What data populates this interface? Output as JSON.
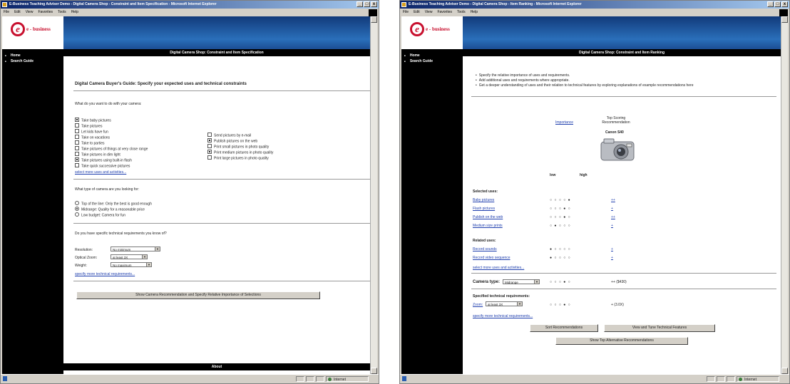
{
  "left_window": {
    "title": "E-Business Teaching Adviser Demo - Digital Camera Shop - Constraint and Item Specification - Microsoft Internet Explorer",
    "menu": [
      "File",
      "Edit",
      "View",
      "Favorites",
      "Tools",
      "Help"
    ],
    "brand": "e - business",
    "nav": [
      "Home",
      "Search Guide"
    ],
    "banner": "Digital Camera Shop: Constraint and Item Specification",
    "heading": "Digital Camera Buyer's Guide: Specify your expected uses and technical constraints",
    "q_uses": "What do you want to do with your camera:",
    "uses_col1": [
      {
        "label": "Take baby pictures",
        "checked": true
      },
      {
        "label": "Take pictures",
        "checked": false
      },
      {
        "label": "Let kids have fun",
        "checked": false
      },
      {
        "label": "Take on vacations",
        "checked": false
      },
      {
        "label": "Take to parties",
        "checked": false
      },
      {
        "label": "Take pictures of things at very close range",
        "checked": false
      },
      {
        "label": "Take pictures in dim light",
        "checked": false
      },
      {
        "label": "Take pictures using built-in flash",
        "checked": true
      },
      {
        "label": "Take quick successive pictures",
        "checked": false
      }
    ],
    "uses_col2": [
      {
        "label": "Send pictures by e-mail",
        "checked": false
      },
      {
        "label": "Publish pictures on the web",
        "checked": true
      },
      {
        "label": "Print small pictures in photo quality",
        "checked": false
      },
      {
        "label": "Print medium pictures in photo quality",
        "checked": true
      },
      {
        "label": "Print large pictures in photo quality",
        "checked": false
      }
    ],
    "link_more_uses": "select more uses and activities...",
    "q_type": "What type of camera are you looking for:",
    "types": [
      {
        "label": "Top of the line: Only the best is good enough",
        "checked": false
      },
      {
        "label": "Midrange: Quality for a reasonable price",
        "checked": true
      },
      {
        "label": "Low budget: Camera for fun",
        "checked": false
      }
    ],
    "q_tech": "Do you have specific technical requirements you know of?",
    "tech": [
      {
        "label": "Resolution:",
        "value": "No minimum"
      },
      {
        "label": "Optical Zoom:",
        "value": "at least 3X"
      },
      {
        "label": "Weight:",
        "value": "No maximum"
      }
    ],
    "link_more_tech": "specify more technical requirements...",
    "button": "Show Camera Recommendation and Specify Relative Importance of Selections",
    "footer": "About"
  },
  "right_window": {
    "title": "E-Business Teaching Adviser Demo - Digital Camera Shop - Item Ranking - Microsoft Internet Explorer",
    "menu": [
      "File",
      "Edit",
      "View",
      "Favorites",
      "Tools",
      "Help"
    ],
    "brand": "e - business",
    "nav": [
      "Home",
      "Search Guide"
    ],
    "banner": "Digital Camera Shop: Constraint and Item Ranking",
    "bullets": [
      "Specify the relative importance of uses and requirements.",
      "Add additional uses and requirements where appropriate.",
      "Get a deeper understanding of uses and their relation to technical features by exploring explanations of example recommendations here"
    ],
    "importance_link": "Importance",
    "top_label": "Top Scoring Recommendation",
    "camera_name": "Canon S40",
    "camera_icon": "digital-camera-photo",
    "low": "low",
    "high": "high",
    "selected_uses_title": "Selected uses:",
    "selected_uses": [
      {
        "label": "Baby pictures",
        "score": "++"
      },
      {
        "label": "Flash pictures",
        "score": "+"
      },
      {
        "label": "Publish on the web",
        "score": "++"
      },
      {
        "label": "Medium size prints",
        "score": "+"
      }
    ],
    "related_uses_title": "Related uses:",
    "related_uses": [
      {
        "label": "Record sounds",
        "score": "+"
      },
      {
        "label": "Record video sequence",
        "score": "+"
      }
    ],
    "link_more_uses": "select more uses and activities...",
    "camera_type_label": "Camera type:",
    "camera_type_value": "Midrange",
    "camera_type_score": "++ ($430)",
    "tech_title": "Specified technical requirements:",
    "zoom_label": "Zoom:",
    "zoom_value": "at least 3X",
    "zoom_score": "+ (3.0X)",
    "link_more_tech": "specify more technical requirements...",
    "buttons": [
      "Sort Recommendations",
      "View and Tune Technical Features",
      "Show Top Alternative Recommendations"
    ],
    "status_zone": "Internet"
  },
  "left_status_zone": "Internet"
}
